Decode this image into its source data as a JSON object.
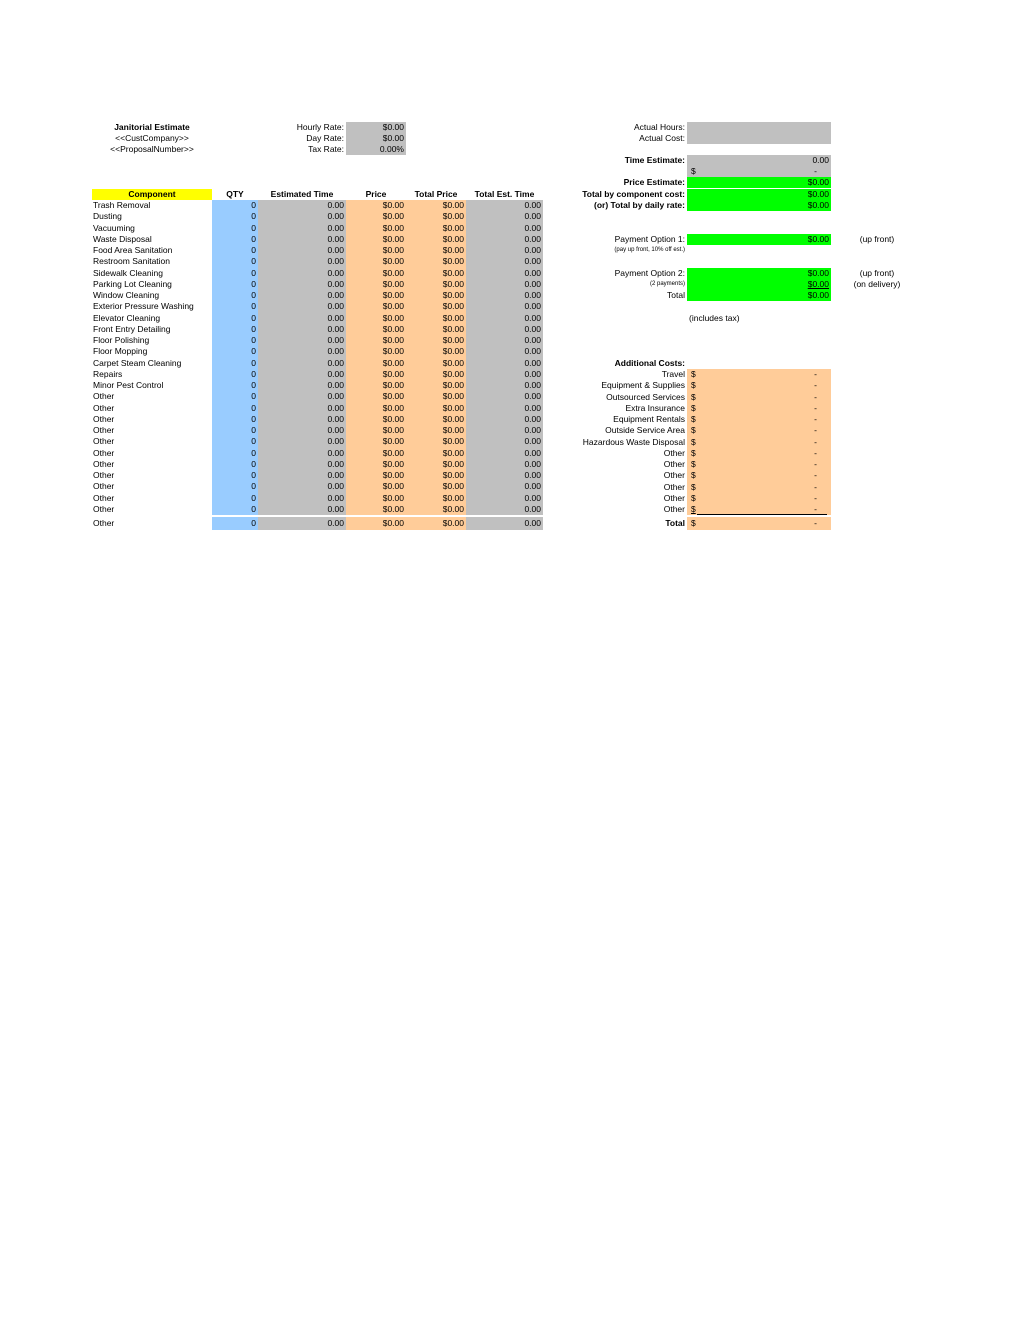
{
  "header": {
    "title": "Janitorial Estimate",
    "company": "<<CustCompany>>",
    "proposal": "<<ProposalNumber>>",
    "rates": [
      {
        "label": "Hourly Rate:",
        "value": "$0.00"
      },
      {
        "label": "Day Rate:",
        "value": "$0.00"
      },
      {
        "label": "Tax Rate:",
        "value": "0.00%"
      }
    ]
  },
  "table": {
    "columns": [
      "Component",
      "QTY",
      "Estimated Time",
      "Price",
      "Total Price",
      "Total Est. Time"
    ],
    "rows": [
      {
        "component": "Trash Removal",
        "qty": "0",
        "est_time": "0.00",
        "price": "$0.00",
        "total_price": "$0.00",
        "total_time": "0.00"
      },
      {
        "component": "Dusting",
        "qty": "0",
        "est_time": "0.00",
        "price": "$0.00",
        "total_price": "$0.00",
        "total_time": "0.00"
      },
      {
        "component": "Vacuuming",
        "qty": "0",
        "est_time": "0.00",
        "price": "$0.00",
        "total_price": "$0.00",
        "total_time": "0.00"
      },
      {
        "component": "Waste Disposal",
        "qty": "0",
        "est_time": "0.00",
        "price": "$0.00",
        "total_price": "$0.00",
        "total_time": "0.00"
      },
      {
        "component": "Food Area Sanitation",
        "qty": "0",
        "est_time": "0.00",
        "price": "$0.00",
        "total_price": "$0.00",
        "total_time": "0.00"
      },
      {
        "component": "Restroom Sanitation",
        "qty": "0",
        "est_time": "0.00",
        "price": "$0.00",
        "total_price": "$0.00",
        "total_time": "0.00"
      },
      {
        "component": "Sidewalk Cleaning",
        "qty": "0",
        "est_time": "0.00",
        "price": "$0.00",
        "total_price": "$0.00",
        "total_time": "0.00"
      },
      {
        "component": "Parking Lot Cleaning",
        "qty": "0",
        "est_time": "0.00",
        "price": "$0.00",
        "total_price": "$0.00",
        "total_time": "0.00"
      },
      {
        "component": "Window Cleaning",
        "qty": "0",
        "est_time": "0.00",
        "price": "$0.00",
        "total_price": "$0.00",
        "total_time": "0.00"
      },
      {
        "component": "Exterior Pressure Washing",
        "qty": "0",
        "est_time": "0.00",
        "price": "$0.00",
        "total_price": "$0.00",
        "total_time": "0.00"
      },
      {
        "component": "Elevator Cleaning",
        "qty": "0",
        "est_time": "0.00",
        "price": "$0.00",
        "total_price": "$0.00",
        "total_time": "0.00"
      },
      {
        "component": "Front Entry Detailing",
        "qty": "0",
        "est_time": "0.00",
        "price": "$0.00",
        "total_price": "$0.00",
        "total_time": "0.00"
      },
      {
        "component": "Floor Polishing",
        "qty": "0",
        "est_time": "0.00",
        "price": "$0.00",
        "total_price": "$0.00",
        "total_time": "0.00"
      },
      {
        "component": "Floor Mopping",
        "qty": "0",
        "est_time": "0.00",
        "price": "$0.00",
        "total_price": "$0.00",
        "total_time": "0.00"
      },
      {
        "component": "Carpet Steam Cleaning",
        "qty": "0",
        "est_time": "0.00",
        "price": "$0.00",
        "total_price": "$0.00",
        "total_time": "0.00"
      },
      {
        "component": "Repairs",
        "qty": "0",
        "est_time": "0.00",
        "price": "$0.00",
        "total_price": "$0.00",
        "total_time": "0.00"
      },
      {
        "component": "Minor Pest Control",
        "qty": "0",
        "est_time": "0.00",
        "price": "$0.00",
        "total_price": "$0.00",
        "total_time": "0.00"
      },
      {
        "component": "Other",
        "qty": "0",
        "est_time": "0.00",
        "price": "$0.00",
        "total_price": "$0.00",
        "total_time": "0.00"
      },
      {
        "component": "Other",
        "qty": "0",
        "est_time": "0.00",
        "price": "$0.00",
        "total_price": "$0.00",
        "total_time": "0.00"
      },
      {
        "component": "Other",
        "qty": "0",
        "est_time": "0.00",
        "price": "$0.00",
        "total_price": "$0.00",
        "total_time": "0.00"
      },
      {
        "component": "Other",
        "qty": "0",
        "est_time": "0.00",
        "price": "$0.00",
        "total_price": "$0.00",
        "total_time": "0.00"
      },
      {
        "component": "Other",
        "qty": "0",
        "est_time": "0.00",
        "price": "$0.00",
        "total_price": "$0.00",
        "total_time": "0.00"
      },
      {
        "component": "Other",
        "qty": "0",
        "est_time": "0.00",
        "price": "$0.00",
        "total_price": "$0.00",
        "total_time": "0.00"
      },
      {
        "component": "Other",
        "qty": "0",
        "est_time": "0.00",
        "price": "$0.00",
        "total_price": "$0.00",
        "total_time": "0.00"
      },
      {
        "component": "Other",
        "qty": "0",
        "est_time": "0.00",
        "price": "$0.00",
        "total_price": "$0.00",
        "total_time": "0.00"
      },
      {
        "component": "Other",
        "qty": "0",
        "est_time": "0.00",
        "price": "$0.00",
        "total_price": "$0.00",
        "total_time": "0.00"
      },
      {
        "component": "Other",
        "qty": "0",
        "est_time": "0.00",
        "price": "$0.00",
        "total_price": "$0.00",
        "total_time": "0.00"
      },
      {
        "component": "Other",
        "qty": "0",
        "est_time": "0.00",
        "price": "$0.00",
        "total_price": "$0.00",
        "total_time": "0.00"
      },
      {
        "component": "Other",
        "qty": "0",
        "est_time": "0.00",
        "price": "$0.00",
        "total_price": "$0.00",
        "total_time": "0.00"
      }
    ]
  },
  "summary": {
    "actual_hours_label": "Actual Hours:",
    "actual_hours_value": "",
    "actual_cost_label": "Actual Cost:",
    "actual_cost_value": "",
    "time_estimate_label": "Time Estimate:",
    "time_estimate_value": "0.00",
    "time_cost_currency": "$",
    "time_cost_value": "-",
    "price_estimate_label": "Price Estimate:",
    "price_estimate_value": "$0.00",
    "component_cost_label": "Total by component cost:",
    "component_cost_value": "$0.00",
    "daily_rate_label": "(or) Total by daily rate:",
    "daily_rate_value": "$0.00"
  },
  "payments": {
    "option1_label": "Payment Option 1:",
    "option1_value": "$0.00",
    "option1_note": "(up front)",
    "option1_sub": "(pay up front, 10% off est.)",
    "option2_label": "Payment Option 2:",
    "option2_value1": "$0.00",
    "option2_note1": "(up front)",
    "option2_sub": "(2 payments)",
    "option2_value2": "$0.00",
    "option2_note2": "(on delivery)",
    "option2_total_label": "Total",
    "option2_total_value": "$0.00",
    "tax_note": "(includes tax)"
  },
  "additional_costs": {
    "title": "Additional Costs:",
    "currency": "$",
    "items": [
      {
        "label": "Travel",
        "value": "-"
      },
      {
        "label": "Equipment & Supplies",
        "value": "-"
      },
      {
        "label": "Outsourced Services",
        "value": "-"
      },
      {
        "label": "Extra Insurance",
        "value": "-"
      },
      {
        "label": "Equipment Rentals",
        "value": "-"
      },
      {
        "label": "Outside Service Area",
        "value": "-"
      },
      {
        "label": "Hazardous Waste Disposal",
        "value": "-"
      },
      {
        "label": "Other",
        "value": "-"
      },
      {
        "label": "Other",
        "value": "-"
      },
      {
        "label": "Other",
        "value": "-"
      },
      {
        "label": "Other",
        "value": "-"
      },
      {
        "label": "Other",
        "value": "-"
      },
      {
        "label": "Other",
        "value": "-"
      }
    ],
    "total_label": "Total",
    "total_value": "-"
  },
  "colors": {
    "input_qty": "#99ccff",
    "calculated": "#c0c0c0",
    "price": "#ffcc99",
    "totals": "#00ff00",
    "header_highlight": "#ffff00"
  }
}
